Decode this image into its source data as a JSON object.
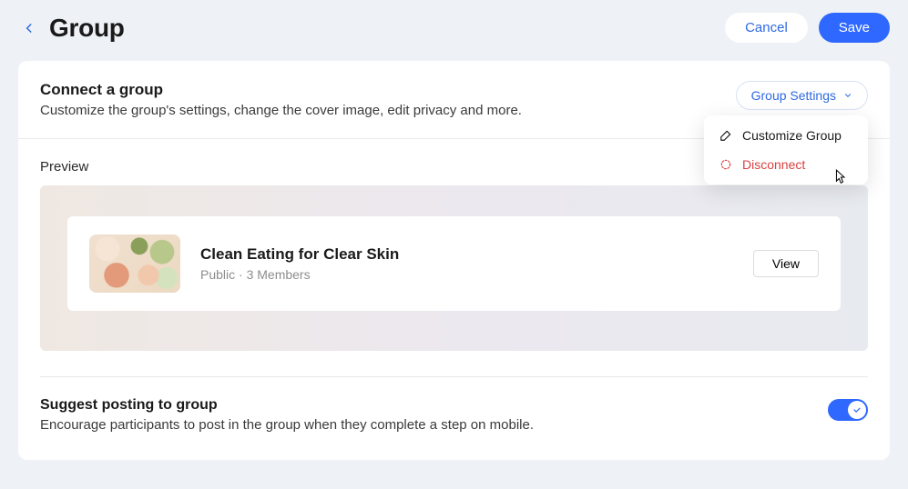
{
  "header": {
    "title": "Group",
    "cancel_label": "Cancel",
    "save_label": "Save"
  },
  "connect": {
    "title": "Connect a group",
    "description": "Customize the group's settings, change the cover image, edit privacy and more.",
    "settings_label": "Group Settings",
    "dropdown": {
      "customize": "Customize Group",
      "disconnect": "Disconnect"
    }
  },
  "preview": {
    "label": "Preview",
    "group_name": "Clean Eating for Clear Skin",
    "group_meta": "Public · 3 Members",
    "view_label": "View"
  },
  "suggest": {
    "title": "Suggest posting to group",
    "description": "Encourage participants to post in the group when they complete a step on mobile.",
    "enabled": true
  }
}
